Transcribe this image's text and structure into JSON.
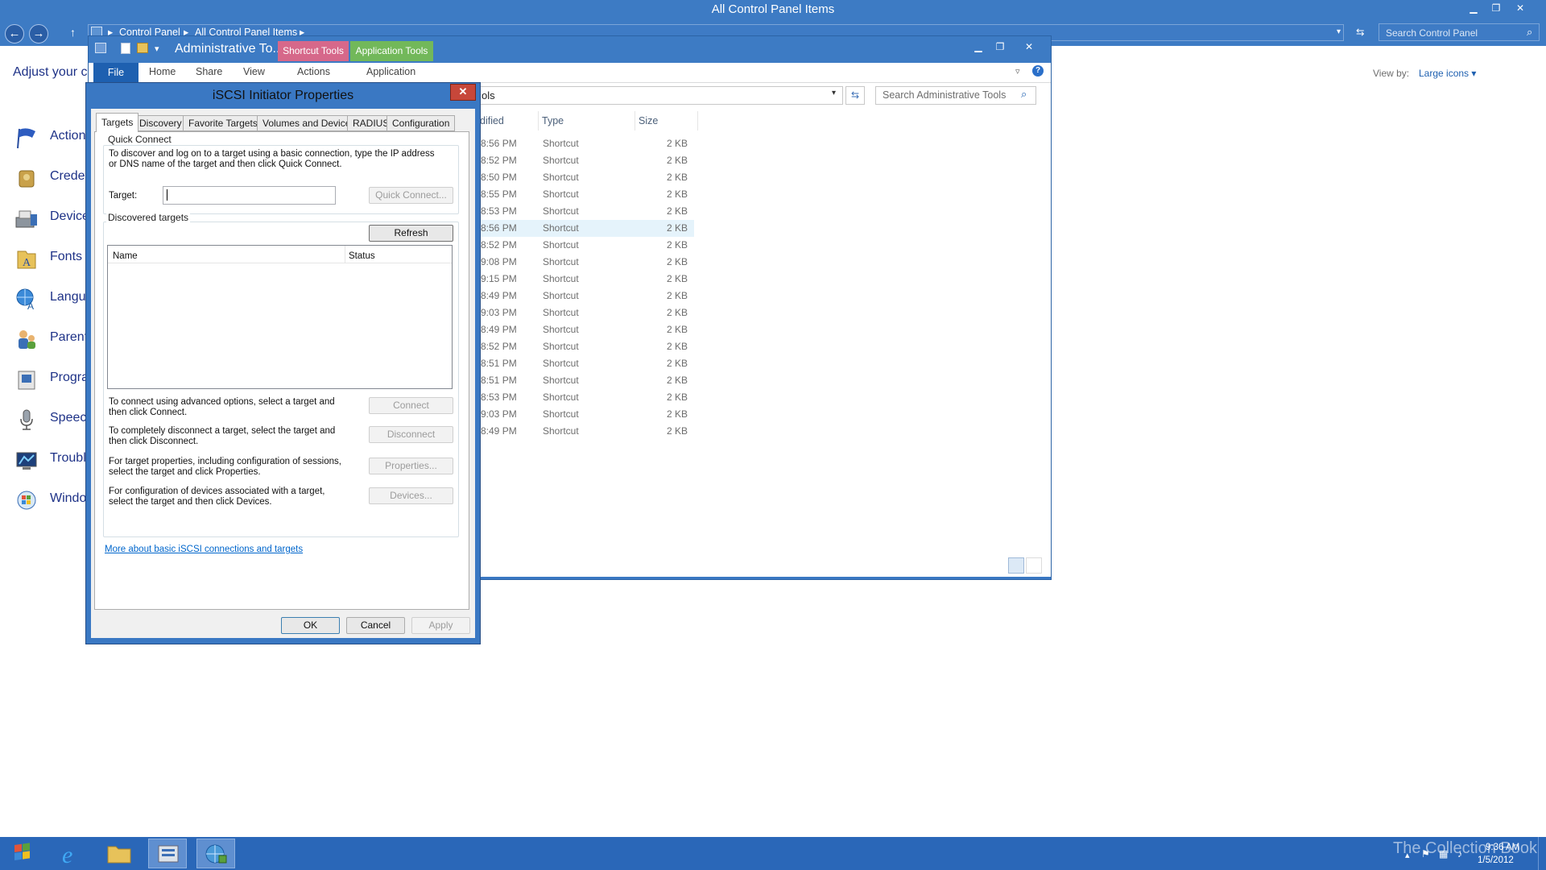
{
  "control_panel": {
    "title": "All Control Panel Items",
    "breadcrumb": [
      "Control Panel",
      "All Control Panel Items"
    ],
    "search_placeholder": "Search Control Panel",
    "heading": "Adjust your c",
    "view_by_label": "View by:",
    "view_by_value": "Large icons",
    "items": [
      {
        "label": "Action",
        "icon": "action-center-flag-icon"
      },
      {
        "label": "Creder",
        "icon": "credential-manager-icon"
      },
      {
        "label": "Device",
        "icon": "devices-printers-icon"
      },
      {
        "label": "Fonts",
        "icon": "fonts-folder-icon"
      },
      {
        "label": "Langu",
        "icon": "language-icon"
      },
      {
        "label": "Parent",
        "icon": "parental-controls-icon"
      },
      {
        "label": "Progra",
        "icon": "programs-icon"
      },
      {
        "label": "Speecl",
        "icon": "speech-microphone-icon"
      },
      {
        "label": "Troubl",
        "icon": "troubleshooting-icon"
      },
      {
        "label": "Windo",
        "icon": "windows-update-icon"
      }
    ]
  },
  "admin_tools": {
    "title": "Administrative To...",
    "context_tabs": {
      "shortcut": "Shortcut Tools",
      "application": "Application Tools"
    },
    "ribbon_tabs": [
      "File",
      "Home",
      "Share",
      "View"
    ],
    "context_subtabs": {
      "shortcut": "Actions",
      "application": "Application"
    },
    "address_tail": "ols",
    "search_placeholder": "Search Administrative Tools",
    "columns": {
      "modified": "dified",
      "type": "Type",
      "size": "Size"
    },
    "rows": [
      {
        "time": "8:56 PM",
        "type": "Shortcut",
        "size": "2 KB"
      },
      {
        "time": "8:52 PM",
        "type": "Shortcut",
        "size": "2 KB"
      },
      {
        "time": "8:50 PM",
        "type": "Shortcut",
        "size": "2 KB"
      },
      {
        "time": "8:55 PM",
        "type": "Shortcut",
        "size": "2 KB"
      },
      {
        "time": "8:53 PM",
        "type": "Shortcut",
        "size": "2 KB"
      },
      {
        "time": "8:56 PM",
        "type": "Shortcut",
        "size": "2 KB",
        "selected": true
      },
      {
        "time": "8:52 PM",
        "type": "Shortcut",
        "size": "2 KB"
      },
      {
        "time": "9:08 PM",
        "type": "Shortcut",
        "size": "2 KB"
      },
      {
        "time": "9:15 PM",
        "type": "Shortcut",
        "size": "2 KB"
      },
      {
        "time": "8:49 PM",
        "type": "Shortcut",
        "size": "2 KB"
      },
      {
        "time": "9:03 PM",
        "type": "Shortcut",
        "size": "2 KB"
      },
      {
        "time": "8:49 PM",
        "type": "Shortcut",
        "size": "2 KB"
      },
      {
        "time": "8:52 PM",
        "type": "Shortcut",
        "size": "2 KB"
      },
      {
        "time": "8:51 PM",
        "type": "Shortcut",
        "size": "2 KB"
      },
      {
        "time": "8:51 PM",
        "type": "Shortcut",
        "size": "2 KB"
      },
      {
        "time": "8:53 PM",
        "type": "Shortcut",
        "size": "2 KB"
      },
      {
        "time": "9:03 PM",
        "type": "Shortcut",
        "size": "2 KB"
      },
      {
        "time": "8:49 PM",
        "type": "Shortcut",
        "size": "2 KB"
      }
    ]
  },
  "dialog": {
    "title": "iSCSI Initiator Properties",
    "tabs": [
      "Targets",
      "Discovery",
      "Favorite Targets",
      "Volumes and Devices",
      "RADIUS",
      "Configuration"
    ],
    "active_tab": "Targets",
    "quick_connect": {
      "group_label": "Quick Connect",
      "description": "To discover and log on to a target using a basic connection, type the IP address or DNS name of the target and then click Quick Connect.",
      "target_label": "Target:",
      "target_value": "",
      "button": "Quick Connect..."
    },
    "discovered": {
      "group_label": "Discovered targets",
      "refresh_button": "Refresh",
      "columns": [
        "Name",
        "Status"
      ],
      "rows": []
    },
    "actions": [
      {
        "text": "To connect using advanced options, select a target and then click Connect.",
        "button": "Connect"
      },
      {
        "text": "To completely disconnect a target, select the target and then click Disconnect.",
        "button": "Disconnect"
      },
      {
        "text": "For target properties, including configuration of sessions, select the target and click Properties.",
        "button": "Properties..."
      },
      {
        "text": "For configuration of devices associated with a target, select the target and then click Devices.",
        "button": "Devices..."
      }
    ],
    "link": "More about basic iSCSI connections and targets",
    "buttons": {
      "ok": "OK",
      "cancel": "Cancel",
      "apply": "Apply"
    }
  },
  "taskbar": {
    "apps": [
      "start-button",
      "internet-explorer-icon",
      "file-explorer-icon",
      "server-manager-icon",
      "iscsi-initiator-icon"
    ],
    "watermark": "The Collection Book",
    "clock_time": "9:36 AM",
    "clock_date": "1/5/2012"
  },
  "colors": {
    "titlebar": "#3d7bc4",
    "taskbar": "#2a67b8",
    "link": "#0066cc",
    "heading": "#1e3287"
  }
}
